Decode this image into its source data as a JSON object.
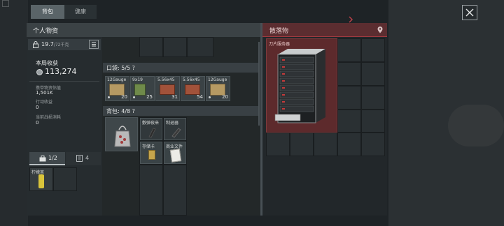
{
  "tabs": [
    {
      "label": "背包"
    },
    {
      "label": "健康"
    }
  ],
  "left_panel": {
    "title": "个人物资",
    "weight_current": "19.7",
    "weight_max": "/72千克",
    "earnings_label": "本局收获",
    "earnings_value": "113,274",
    "stats": [
      {
        "label": "携带物资估值",
        "value": "1,501K"
      },
      {
        "label": "行动收益",
        "value": "0"
      },
      {
        "label": "当前战损消耗",
        "value": "0"
      }
    ],
    "bottom_tabs": [
      {
        "label": "1/2"
      },
      {
        "label": "4"
      }
    ],
    "safe_item": {
      "name": "柠檬茶"
    }
  },
  "pocket": {
    "header": "口袋: 5/5 ?",
    "items": [
      {
        "name": "12Gauge",
        "sub": "F",
        "qty": "20"
      },
      {
        "name": "9x19",
        "sub": "P",
        "qty": "25"
      },
      {
        "name": "5.56x45",
        "sub": "",
        "qty": "31"
      },
      {
        "name": "5.56x45",
        "sub": "F",
        "qty": "54"
      },
      {
        "name": "12Gauge",
        "sub": "F",
        "qty": "20"
      }
    ]
  },
  "backpack": {
    "header": "背包: 4/8 ?",
    "items": [
      {
        "name": "敷弹夜来"
      },
      {
        "name": "制退器"
      },
      {
        "name": "存储卡"
      },
      {
        "name": "商业文件"
      }
    ]
  },
  "loot": {
    "title": "散落物",
    "item": {
      "name": "刀片服务器"
    }
  },
  "colors": {
    "loot_accent": "#a03a40",
    "panel_bg": "#262c2f",
    "tab_active": "#5a6468"
  },
  "icons": [
    "close-icon",
    "weight-icon",
    "list-icon",
    "coin-icon",
    "location-pin-icon",
    "toolbox-icon",
    "safe-icon",
    "chevron-icon"
  ]
}
